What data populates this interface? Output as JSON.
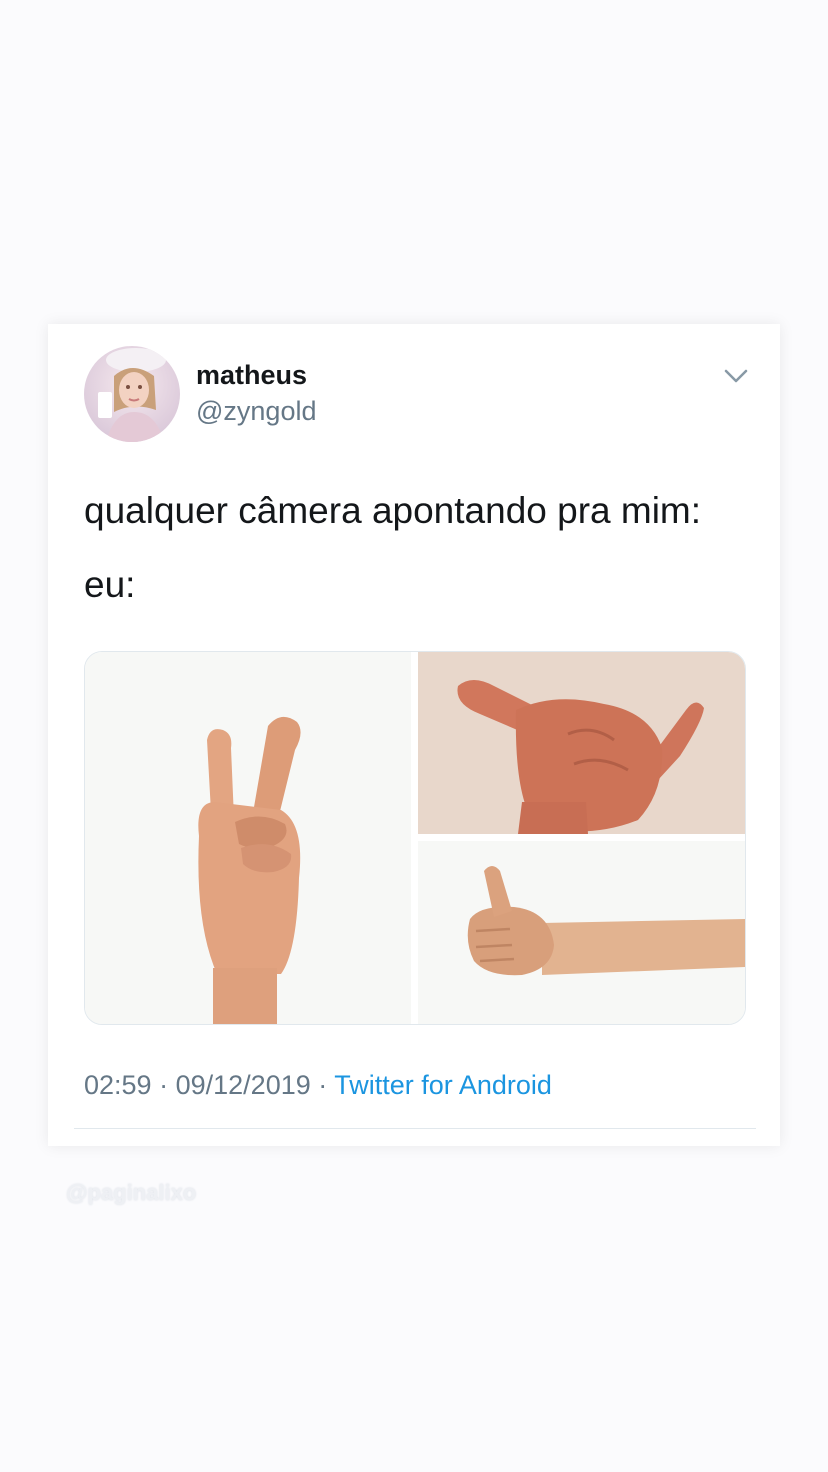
{
  "tweet": {
    "author": {
      "display_name": "matheus",
      "handle": "@zyngold"
    },
    "text_lines": [
      "qualquer câmera apontando pra mim:",
      "eu:"
    ],
    "media": [
      {
        "description": "hand making peace sign"
      },
      {
        "description": "hand making shaka sign"
      },
      {
        "description": "arm giving thumbs up"
      }
    ],
    "time": "02:59",
    "date": "09/12/2019",
    "separator": "·",
    "source": "Twitter for Android"
  },
  "watermark": "@paginalixo",
  "colors": {
    "name": "#14171a",
    "secondary": "#657786",
    "link": "#1b95e0",
    "border": "#e1e8ed"
  },
  "icons": {
    "menu": "chevron-down-icon"
  }
}
